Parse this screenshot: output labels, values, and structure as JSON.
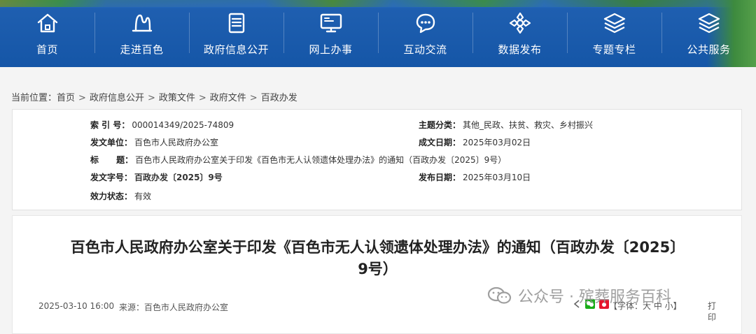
{
  "nav": {
    "items": [
      {
        "label": "首页",
        "icon": "home-icon"
      },
      {
        "label": "走进百色",
        "icon": "mountain-icon"
      },
      {
        "label": "政府信息公开",
        "icon": "document-icon"
      },
      {
        "label": "网上办事",
        "icon": "monitor-icon"
      },
      {
        "label": "互动交流",
        "icon": "chat-icon"
      },
      {
        "label": "数据发布",
        "icon": "data-icon"
      },
      {
        "label": "专题专栏",
        "icon": "layers-icon"
      },
      {
        "label": "公共服务",
        "icon": "stack-icon"
      }
    ]
  },
  "breadcrumb": {
    "prefix": "当前位置：",
    "items": [
      "首页",
      "政府信息公开",
      "政策文件",
      "政府文件",
      "百政办发"
    ],
    "sep": ">"
  },
  "info": {
    "index_label": "索  引 号：",
    "index_value": "000014349/2025-74809",
    "topic_label": "主题分类：",
    "topic_value": "其他_民政、扶贫、救灾、乡村振兴",
    "issuer_label": "发文单位：",
    "issuer_value": "百色市人民政府办公室",
    "created_label": "成文日期：",
    "created_value": "2025年03月02日",
    "title_label": "标      题：",
    "title_value": "百色市人民政府办公室关于印发《百色市无人认领遗体处理办法》的通知（百政办发〔2025〕9号）",
    "doc_no_label": "发文字号：",
    "doc_no_value": "百政办发〔2025〕9号",
    "published_label": "发布日期：",
    "published_value": "2025年03月10日",
    "status_label": "效力状态：",
    "status_value": "有效"
  },
  "article": {
    "title_line1": "百色市人民政府办公室关于印发《百色市无人认领遗体处理办法》的通知（百政办发〔2025〕",
    "title_line2": "9号）",
    "date": "2025-03-10 16:00",
    "source_label": "来源：",
    "source_value": "百色市人民政府办公室",
    "font_label": "【字体：大 中 小】",
    "print_label": "打印"
  },
  "watermark": {
    "text": "公众号 · 殡葬服务百科"
  },
  "colors": {
    "nav_bg": "#1556a7",
    "panel_border": "#e1e1e1",
    "page_bg": "#f4f4f4"
  }
}
